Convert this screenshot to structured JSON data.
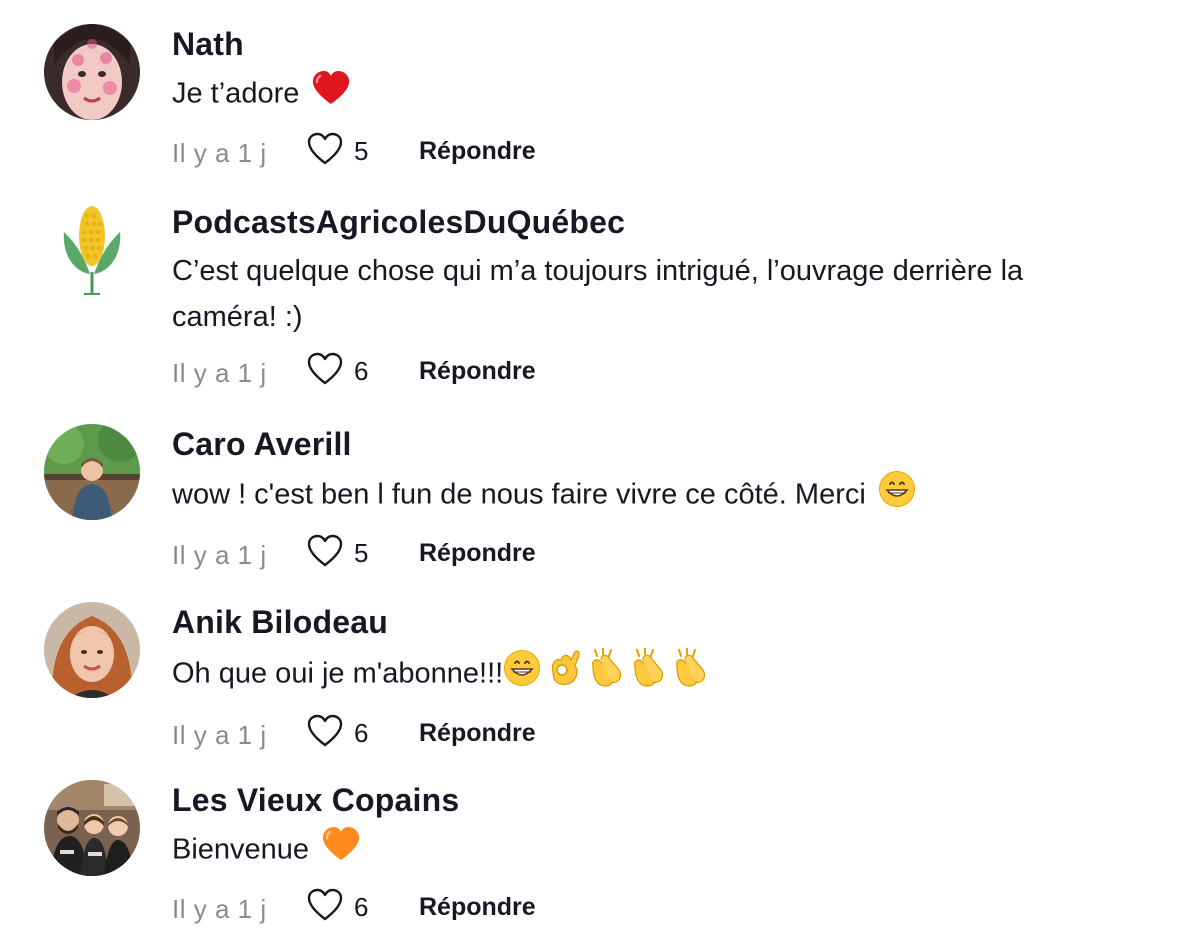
{
  "comments": [
    {
      "username": "Nath",
      "text": "Je t’adore",
      "emoji": [
        "heart-red"
      ],
      "time": "Il y a 1 j",
      "likes": "5",
      "reply_label": "Répondre"
    },
    {
      "username": "PodcastsAgricolesDuQuébec",
      "text": "C’est quelque chose qui m’a toujours intrigué, l’ouvrage derrière la caméra! :)",
      "emoji": [],
      "time": "Il y a 1 j",
      "likes": "6",
      "reply_label": "Répondre"
    },
    {
      "username": "Caro Averill",
      "text": "wow ! c'est ben l fun de nous faire vivre ce côté. Merci",
      "emoji": [
        "grinning-face"
      ],
      "time": "Il y a 1 j",
      "likes": "5",
      "reply_label": "Répondre"
    },
    {
      "username": "Anik Bilodeau",
      "text": "Oh que oui je m'abonne!!!",
      "emoji": [
        "grinning-face",
        "ok-hand",
        "clapping-hands",
        "clapping-hands",
        "clapping-hands"
      ],
      "time": "Il y a 1 j",
      "likes": "6",
      "reply_label": "Répondre"
    },
    {
      "username": "Les Vieux Copains",
      "text": "Bienvenue",
      "emoji": [
        "heart-orange"
      ],
      "time": "Il y a 1 j",
      "likes": "6",
      "reply_label": "Répondre"
    }
  ],
  "colors": {
    "text": "#161823",
    "muted": "#8a8b91",
    "heart_outline": "#161823"
  }
}
